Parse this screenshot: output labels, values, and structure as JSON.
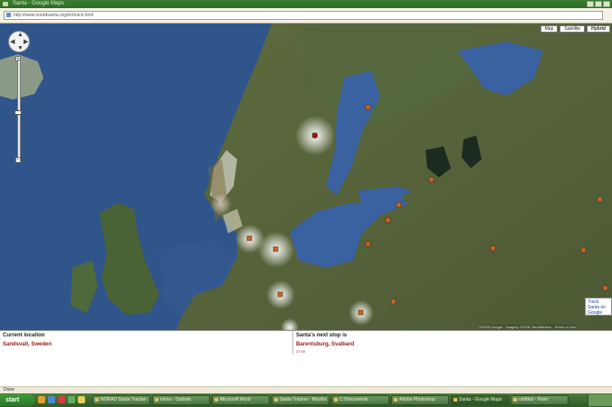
{
  "window": {
    "title": "Santa - Google Maps",
    "address": "http://www.noradsanta.org/en/track.html"
  },
  "map_controls": {
    "map_types": [
      "Map",
      "Satellite",
      "Hybrid"
    ],
    "active_map_type": "Hybrid",
    "zoom_in": "+",
    "zoom_out": "−"
  },
  "street_view_tip": "Track Santa on Google",
  "attribution": "©2009 Google - Imagery ©2009 TerraMetrics - Terms of Use",
  "info": {
    "current_label": "Current location",
    "current_value": "Sandsvall, Sweden",
    "next_label": "Santa's next stop is",
    "next_value": "Barentsburg, Svalbard",
    "eta": "27:39"
  },
  "status": "Done",
  "taskbar": {
    "start": "start",
    "buttons": [
      "NORAD Santa Tracker",
      "Inbox - Outlook",
      "Microsoft Word",
      "Santa Tracker - Mozilla",
      "C:\\Documents",
      "Adobe Photoshop",
      "Santa - Google Maps",
      "untitled - Paint"
    ],
    "active_index": 6
  }
}
